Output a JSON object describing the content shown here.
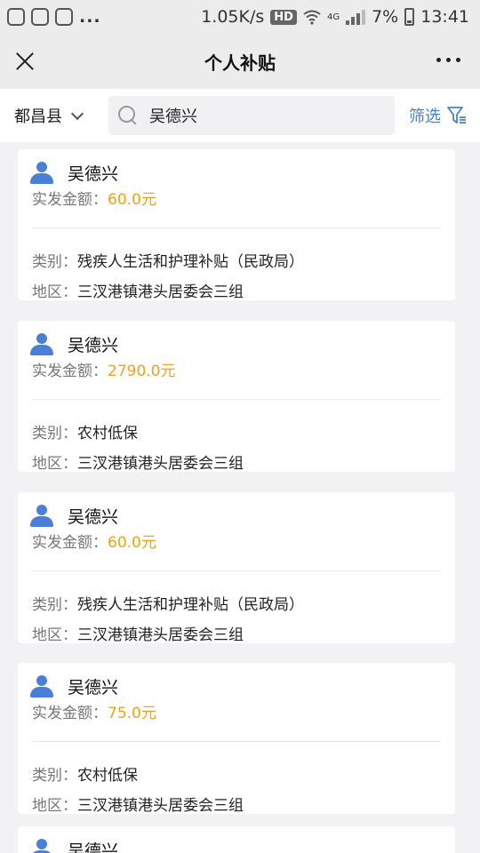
{
  "status_bar": {
    "speed": "1.05K/s",
    "hd": "HD",
    "network": "4G",
    "battery": "7%",
    "time": "13:41",
    "more": "..."
  },
  "nav": {
    "title": "个人补贴"
  },
  "filter": {
    "county": "都昌县",
    "search_value": "吴德兴",
    "filter_label": "筛选"
  },
  "labels": {
    "amount": "实发金额：",
    "category": "类别：",
    "region": "地区："
  },
  "records": [
    {
      "name": "吴德兴",
      "amount": "60.0元",
      "category": "残疾人生活和护理补贴（民政局）",
      "region": "三汊港镇港头居委会三组"
    },
    {
      "name": "吴德兴",
      "amount": "2790.0元",
      "category": "农村低保",
      "region": "三汊港镇港头居委会三组"
    },
    {
      "name": "吴德兴",
      "amount": "60.0元",
      "category": "残疾人生活和护理补贴（民政局）",
      "region": "三汊港镇港头居委会三组"
    },
    {
      "name": "吴德兴",
      "amount": "75.0元",
      "category": "农村低保",
      "region": "三汊港镇港头居委会三组"
    },
    {
      "name": "吴德兴"
    }
  ]
}
